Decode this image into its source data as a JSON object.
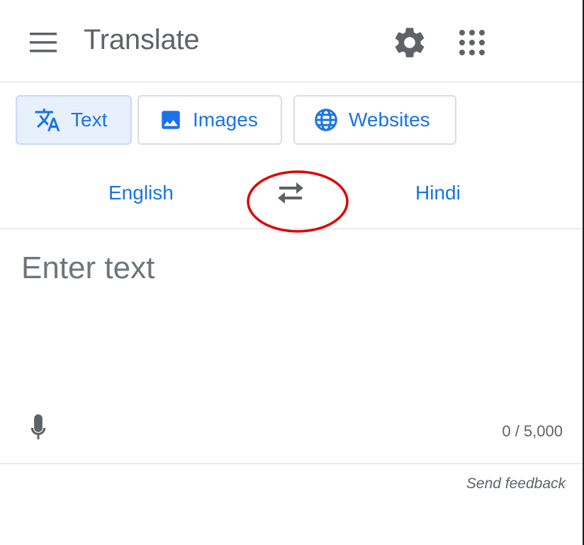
{
  "header": {
    "title": "Translate",
    "menu_icon": "hamburger-menu-icon",
    "settings_icon": "gear-icon",
    "apps_icon": "apps-grid-icon"
  },
  "modes": {
    "text": {
      "label": "Text",
      "icon": "translate-icon",
      "active": true
    },
    "images": {
      "label": "Images",
      "icon": "image-icon",
      "active": false
    },
    "websites": {
      "label": "Websites",
      "icon": "globe-icon",
      "active": false
    }
  },
  "languages": {
    "source": "English",
    "target": "Hindi",
    "swap_icon": "swap-arrows-icon"
  },
  "input": {
    "placeholder": "Enter text",
    "value": "",
    "char_count": "0 / 5,000",
    "mic_icon": "microphone-icon"
  },
  "footer": {
    "feedback": "Send feedback"
  },
  "colors": {
    "accent": "#1a73e8",
    "active_bg": "#e8f0fe",
    "annotation": "#e00000"
  }
}
